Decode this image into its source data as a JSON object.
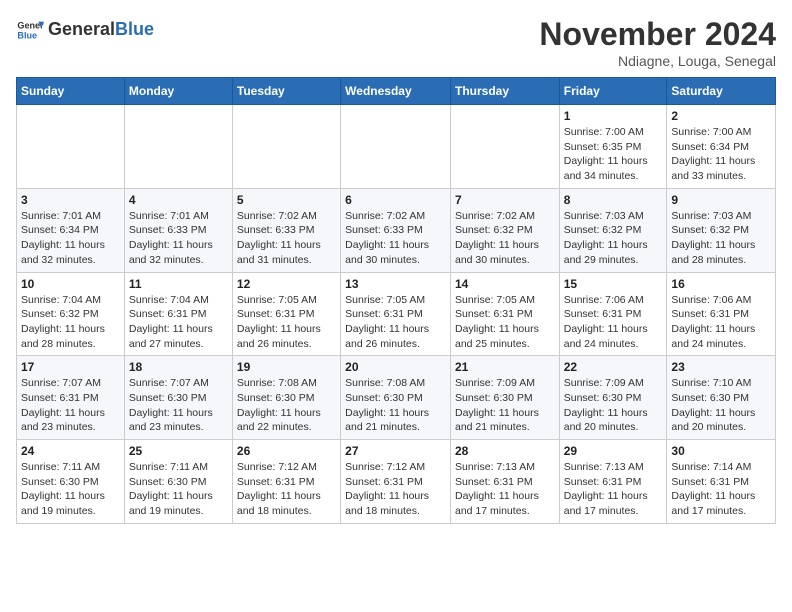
{
  "header": {
    "logo_general": "General",
    "logo_blue": "Blue",
    "month_title": "November 2024",
    "location": "Ndiagne, Louga, Senegal"
  },
  "days_of_week": [
    "Sunday",
    "Monday",
    "Tuesday",
    "Wednesday",
    "Thursday",
    "Friday",
    "Saturday"
  ],
  "weeks": [
    [
      {
        "day": "",
        "info": ""
      },
      {
        "day": "",
        "info": ""
      },
      {
        "day": "",
        "info": ""
      },
      {
        "day": "",
        "info": ""
      },
      {
        "day": "",
        "info": ""
      },
      {
        "day": "1",
        "info": "Sunrise: 7:00 AM\nSunset: 6:35 PM\nDaylight: 11 hours and 34 minutes."
      },
      {
        "day": "2",
        "info": "Sunrise: 7:00 AM\nSunset: 6:34 PM\nDaylight: 11 hours and 33 minutes."
      }
    ],
    [
      {
        "day": "3",
        "info": "Sunrise: 7:01 AM\nSunset: 6:34 PM\nDaylight: 11 hours and 32 minutes."
      },
      {
        "day": "4",
        "info": "Sunrise: 7:01 AM\nSunset: 6:33 PM\nDaylight: 11 hours and 32 minutes."
      },
      {
        "day": "5",
        "info": "Sunrise: 7:02 AM\nSunset: 6:33 PM\nDaylight: 11 hours and 31 minutes."
      },
      {
        "day": "6",
        "info": "Sunrise: 7:02 AM\nSunset: 6:33 PM\nDaylight: 11 hours and 30 minutes."
      },
      {
        "day": "7",
        "info": "Sunrise: 7:02 AM\nSunset: 6:32 PM\nDaylight: 11 hours and 30 minutes."
      },
      {
        "day": "8",
        "info": "Sunrise: 7:03 AM\nSunset: 6:32 PM\nDaylight: 11 hours and 29 minutes."
      },
      {
        "day": "9",
        "info": "Sunrise: 7:03 AM\nSunset: 6:32 PM\nDaylight: 11 hours and 28 minutes."
      }
    ],
    [
      {
        "day": "10",
        "info": "Sunrise: 7:04 AM\nSunset: 6:32 PM\nDaylight: 11 hours and 28 minutes."
      },
      {
        "day": "11",
        "info": "Sunrise: 7:04 AM\nSunset: 6:31 PM\nDaylight: 11 hours and 27 minutes."
      },
      {
        "day": "12",
        "info": "Sunrise: 7:05 AM\nSunset: 6:31 PM\nDaylight: 11 hours and 26 minutes."
      },
      {
        "day": "13",
        "info": "Sunrise: 7:05 AM\nSunset: 6:31 PM\nDaylight: 11 hours and 26 minutes."
      },
      {
        "day": "14",
        "info": "Sunrise: 7:05 AM\nSunset: 6:31 PM\nDaylight: 11 hours and 25 minutes."
      },
      {
        "day": "15",
        "info": "Sunrise: 7:06 AM\nSunset: 6:31 PM\nDaylight: 11 hours and 24 minutes."
      },
      {
        "day": "16",
        "info": "Sunrise: 7:06 AM\nSunset: 6:31 PM\nDaylight: 11 hours and 24 minutes."
      }
    ],
    [
      {
        "day": "17",
        "info": "Sunrise: 7:07 AM\nSunset: 6:31 PM\nDaylight: 11 hours and 23 minutes."
      },
      {
        "day": "18",
        "info": "Sunrise: 7:07 AM\nSunset: 6:30 PM\nDaylight: 11 hours and 23 minutes."
      },
      {
        "day": "19",
        "info": "Sunrise: 7:08 AM\nSunset: 6:30 PM\nDaylight: 11 hours and 22 minutes."
      },
      {
        "day": "20",
        "info": "Sunrise: 7:08 AM\nSunset: 6:30 PM\nDaylight: 11 hours and 21 minutes."
      },
      {
        "day": "21",
        "info": "Sunrise: 7:09 AM\nSunset: 6:30 PM\nDaylight: 11 hours and 21 minutes."
      },
      {
        "day": "22",
        "info": "Sunrise: 7:09 AM\nSunset: 6:30 PM\nDaylight: 11 hours and 20 minutes."
      },
      {
        "day": "23",
        "info": "Sunrise: 7:10 AM\nSunset: 6:30 PM\nDaylight: 11 hours and 20 minutes."
      }
    ],
    [
      {
        "day": "24",
        "info": "Sunrise: 7:11 AM\nSunset: 6:30 PM\nDaylight: 11 hours and 19 minutes."
      },
      {
        "day": "25",
        "info": "Sunrise: 7:11 AM\nSunset: 6:30 PM\nDaylight: 11 hours and 19 minutes."
      },
      {
        "day": "26",
        "info": "Sunrise: 7:12 AM\nSunset: 6:31 PM\nDaylight: 11 hours and 18 minutes."
      },
      {
        "day": "27",
        "info": "Sunrise: 7:12 AM\nSunset: 6:31 PM\nDaylight: 11 hours and 18 minutes."
      },
      {
        "day": "28",
        "info": "Sunrise: 7:13 AM\nSunset: 6:31 PM\nDaylight: 11 hours and 17 minutes."
      },
      {
        "day": "29",
        "info": "Sunrise: 7:13 AM\nSunset: 6:31 PM\nDaylight: 11 hours and 17 minutes."
      },
      {
        "day": "30",
        "info": "Sunrise: 7:14 AM\nSunset: 6:31 PM\nDaylight: 11 hours and 17 minutes."
      }
    ]
  ]
}
